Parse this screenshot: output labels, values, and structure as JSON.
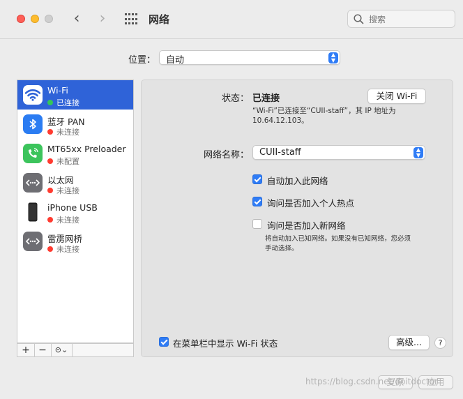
{
  "window": {
    "title": "网络"
  },
  "search": {
    "placeholder": "搜索"
  },
  "location": {
    "label": "位置：",
    "value": "自动"
  },
  "services": [
    {
      "name": "Wi-Fi",
      "status": "已连接",
      "status_color": "#34c759",
      "icon": "wifi-icon",
      "selected": true
    },
    {
      "name": "蓝牙 PAN",
      "status": "未连接",
      "status_color": "#ff3b30",
      "icon": "bluetooth-icon"
    },
    {
      "name": "MT65xx Preloader",
      "status": "未配置",
      "status_color": "#ff3b30",
      "icon": "phone-modem-icon"
    },
    {
      "name": "以太网",
      "status": "未连接",
      "status_color": "#ff3b30",
      "icon": "ethernet-icon"
    },
    {
      "name": "iPhone USB",
      "status": "未连接",
      "status_color": "#ff3b30",
      "icon": "iphone-icon"
    },
    {
      "name": "雷雳网桥",
      "status": "未连接",
      "status_color": "#ff3b30",
      "icon": "bridge-icon"
    }
  ],
  "sidebar_controls": {
    "add": "+",
    "remove": "−",
    "actions": "⊝⌄"
  },
  "detail": {
    "status_label": "状态：",
    "status_value": "已连接",
    "turn_off_button": "关闭 Wi-Fi",
    "status_desc_line1": "“Wi-Fi”已连接至“CUII-staff”，其 IP 地址为",
    "status_desc_line2": "10.64.12.103。",
    "network_name_label": "网络名称：",
    "network_name_value": "CUII-staff",
    "checkboxes": [
      {
        "label": "自动加入此网络",
        "checked": true
      },
      {
        "label": "询问是否加入个人热点",
        "checked": true
      },
      {
        "label": "询问是否加入新网络",
        "checked": false
      }
    ],
    "new_network_note_line1": "将自动加入已知网络。如果没有已知网络，您必须",
    "new_network_note_line2": "手动选择。",
    "show_in_menubar_label": "在菜单栏中显示 Wi-Fi 状态",
    "show_in_menubar_checked": true,
    "advanced_button": "高级...",
    "help_button": "?"
  },
  "footer": {
    "revert_button": "复原",
    "apply_button": "应用"
  },
  "watermark": "https://blog.csdn.net/doitdoctor"
}
